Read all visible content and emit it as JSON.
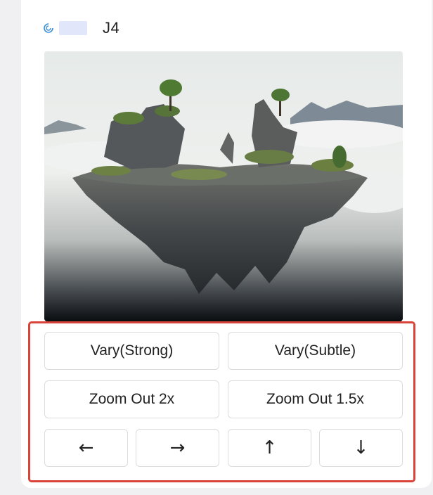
{
  "header": {
    "model_label": "J4",
    "loading_icon": "spinner-icon"
  },
  "image": {
    "alt": "floating-island-artwork",
    "colors": {
      "sky": "#e4e8e5",
      "rock": "#4a4d4a",
      "foliage": "#5c7a3a",
      "shadow": "#0c0f12"
    }
  },
  "actions": {
    "vary_strong": "Vary(Strong)",
    "vary_subtle": "Vary(Subtle)",
    "zoom_out_2x": "Zoom Out 2x",
    "zoom_out_1_5x": "Zoom Out 1.5x",
    "pan_left": "←",
    "pan_right": "→",
    "pan_up": "↑",
    "pan_down": "↓"
  },
  "theme": {
    "highlight_border": "#d9433a",
    "name_placeholder": "#e2e6fb",
    "spinner": "#3a8fd8"
  }
}
